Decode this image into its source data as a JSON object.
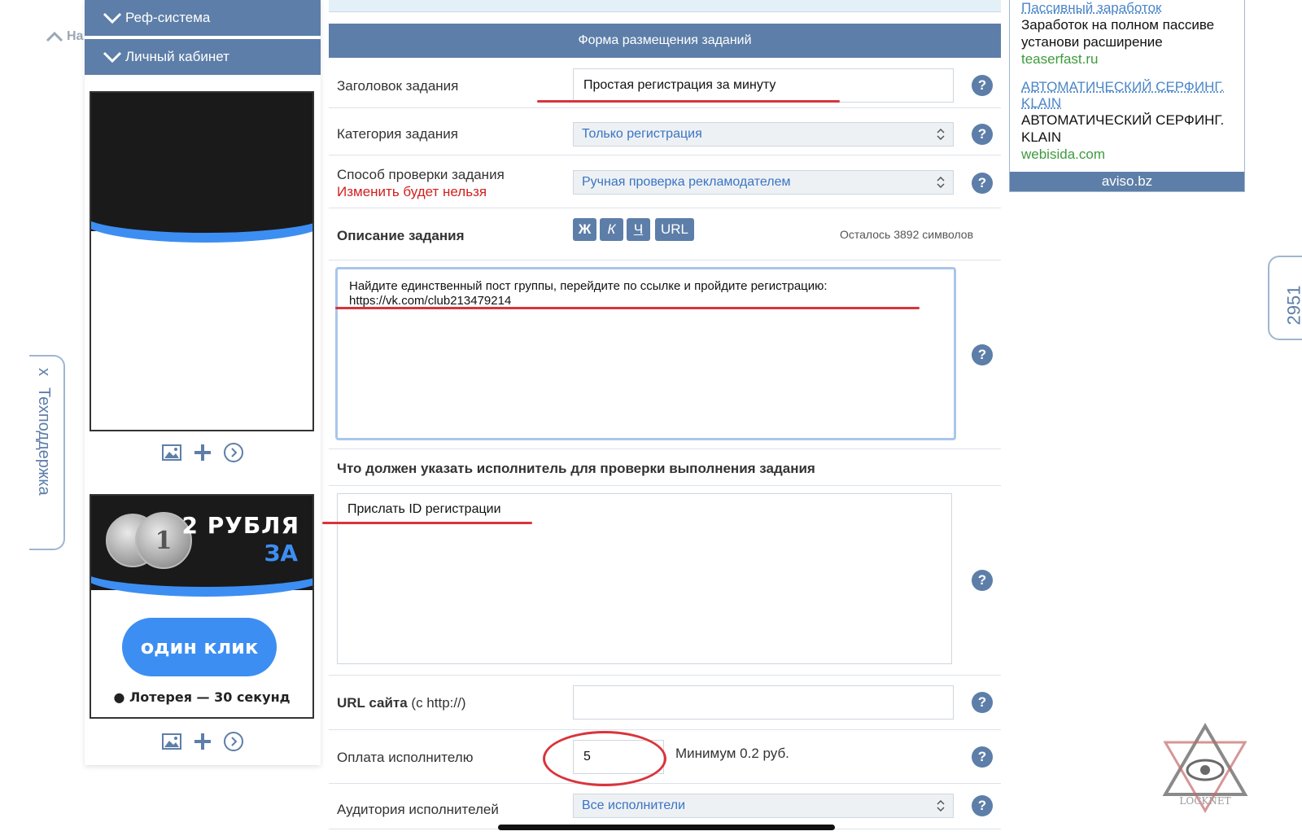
{
  "nav": {
    "scroll_top_label": "На",
    "ref_system": "Реф-система",
    "personal_cabinet": "Личный кабинет"
  },
  "banner2": {
    "coin_text": "1",
    "title": "2 РУБЛЯ",
    "title_2": "ЗА",
    "button": "один клик",
    "footer": "● Лотерея — 30 секунд"
  },
  "support": {
    "close": "x",
    "label": "Техподдержка"
  },
  "form": {
    "header": "Форма размещения заданий",
    "title_label": "Заголовок задания",
    "title_value": "Простая регистрация за минуту",
    "category_label": "Категория задания",
    "category_value": "Только регистрация",
    "check_label": "Способ проверки задания",
    "check_warning": "Изменить будет нельзя",
    "check_value": "Ручная проверка рекламодателем",
    "desc_label": "Описание задания",
    "fmt_bold": "Ж",
    "fmt_italic": "К",
    "fmt_underline": "Ч",
    "fmt_url": "URL",
    "remaining": "Осталось 3892 символов",
    "desc_line1": "Найдите единственный пост группы, перейдите по ссылке и  пройдите регистрацию:",
    "desc_line2": "https://vk.com/club213479214",
    "verify_label": "Что должен указать исполнитель для проверки выполнения задания",
    "verify_value": "Прислать ID регистрации",
    "url_label_bold": "URL сайта",
    "url_label_rest": " (с http://)",
    "url_value": "",
    "pay_label": "Оплата исполнителю",
    "pay_value": "5",
    "pay_note": "Минимум 0.2 руб.",
    "audience_label": "Аудитория исполнителей",
    "audience_value": "Все исполнители",
    "help": "?"
  },
  "ad": {
    "link1": "Пассивный заработок",
    "text1": "Заработок на полном пассиве установи расширение",
    "url1": "teaserfast.ru",
    "link2": "АВТОМАТИЧЕСКИЙ СЕРФИНГ. KLAIN",
    "text2": "АВТОМАТИЧЕСКИЙ СЕРФИНГ. KLAIN",
    "url2": "webisida.com",
    "footer": "aviso.bz"
  },
  "counter": "2951",
  "watermark": "LOCKNET",
  "colors": {
    "accent": "#5d7ea8",
    "link": "#3a74c4",
    "warning": "#d21f1f",
    "annotation": "#d9343c",
    "ad_url": "#3d9b3d"
  }
}
